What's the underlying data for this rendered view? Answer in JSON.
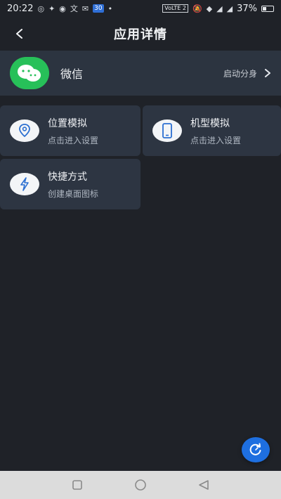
{
  "status_bar": {
    "time": "20:22",
    "notification_badge": "30",
    "network_label": "VoLTE 2",
    "battery_percent": "37%",
    "icons": [
      "weibo-icon",
      "vpn-icon",
      "app-icon",
      "translate-icon",
      "mail-icon",
      "calendar-icon",
      "dot-icon",
      "mute-icon",
      "wifi-icon",
      "signal-icon",
      "signal-icon",
      "battery-icon"
    ]
  },
  "header": {
    "title": "应用详情",
    "back_icon": "chevron-left-icon"
  },
  "app": {
    "name": "微信",
    "clone_label": "启动分身",
    "icon": "wechat-icon",
    "accent": "#27c059"
  },
  "tiles": [
    {
      "title": "位置模拟",
      "subtitle": "点击进入设置",
      "icon": "location-pin-icon"
    },
    {
      "title": "机型模拟",
      "subtitle": "点击进入设置",
      "icon": "phone-icon"
    },
    {
      "title": "快捷方式",
      "subtitle": "创建桌面图标",
      "icon": "lightning-icon"
    }
  ],
  "fab": {
    "icon": "refresh-icon",
    "color": "#1e6fe0"
  },
  "nav_bar": {
    "buttons": [
      "square-icon",
      "circle-icon",
      "triangle-back-icon"
    ]
  },
  "colors": {
    "background": "#1f2228",
    "card": "#2c3440",
    "tile": "#2d3542"
  }
}
